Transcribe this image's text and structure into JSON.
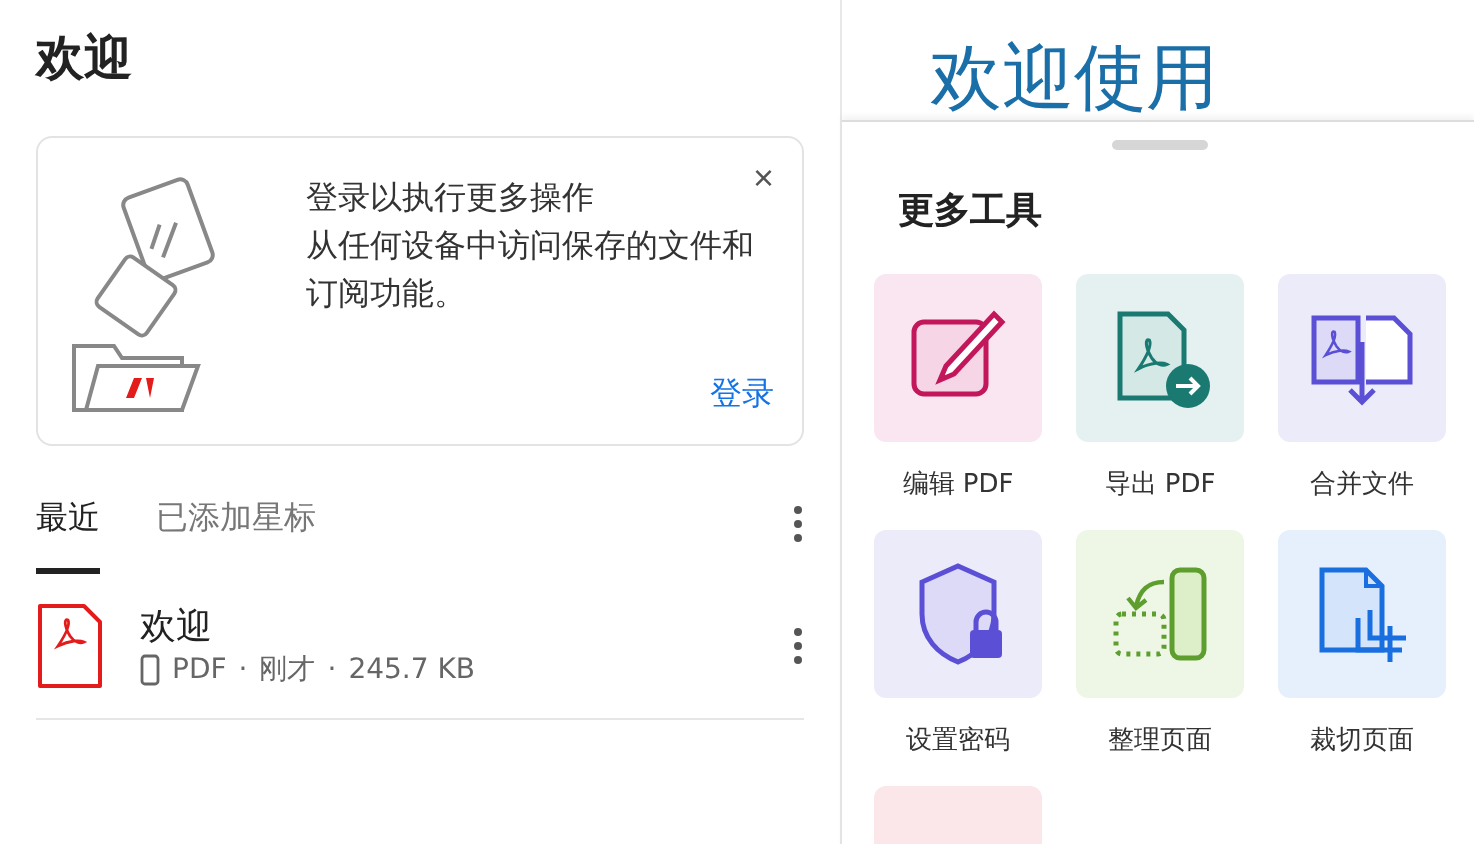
{
  "home": {
    "title": "欢迎",
    "promo": {
      "headline": "登录以执行更多操作",
      "body": "从任何设备中访问保存的文件和订阅功能。",
      "close": "×",
      "action": "登录"
    },
    "tabs": [
      {
        "label": "最近",
        "selected": true
      },
      {
        "label": "已添加星标",
        "selected": false
      }
    ],
    "files": [
      {
        "name": "欢迎",
        "type": "PDF",
        "sep_1": "·",
        "time": "刚才",
        "sep_2": "·",
        "size": "245.7 KB"
      }
    ]
  },
  "side": {
    "heading": "欢迎使用",
    "sheet": {
      "title": "更多工具",
      "tools": [
        {
          "kind": "edit",
          "label": "编辑 PDF",
          "color": "#f9e6f0"
        },
        {
          "kind": "export",
          "label": "导出 PDF",
          "color": "#e4f1f0"
        },
        {
          "kind": "combine",
          "label": "合并文件",
          "color": "#ecebfa"
        },
        {
          "kind": "protect",
          "label": "设置密码",
          "color": "#ecebfa"
        },
        {
          "kind": "organize",
          "label": "整理页面",
          "color": "#eef6e6"
        },
        {
          "kind": "crop",
          "label": "裁切页面",
          "color": "#e6f0fc"
        },
        {
          "kind": "more",
          "color": "#fbe6ea"
        }
      ]
    }
  }
}
